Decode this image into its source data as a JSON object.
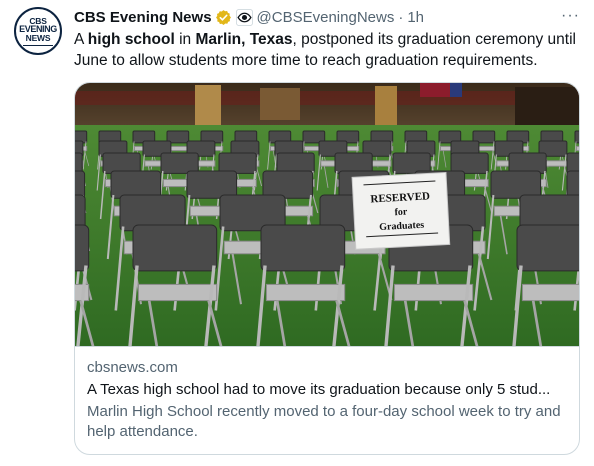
{
  "author": {
    "name": "CBS Evening News",
    "handle": "@CBSEveningNews",
    "separator": "·",
    "time": "1h",
    "avatar_lines": [
      "CBS",
      "EVENING",
      "NEWS"
    ],
    "avatar_icon": "cbs-evening-news-logo",
    "verified_badge": "gold-check-icon",
    "affiliation_icon": "cbs-eye-icon"
  },
  "more_label": "···",
  "tweet_text": [
    {
      "t": "A "
    },
    {
      "t": "high school",
      "bold": true
    },
    {
      "t": " in "
    },
    {
      "t": "Marlin, Texas",
      "bold": true
    },
    {
      "t": ", postponed its graduation ceremony until June to allow students more time to reach graduation requirements."
    }
  ],
  "card": {
    "sign_lines": [
      "RESERVED",
      "for",
      "Graduates"
    ],
    "domain": "cbsnews.com",
    "title": "A Texas high school had to move its graduation because only 5 stud...",
    "description": "Marlin High School recently moved to a four-day school week to try and help attendance."
  },
  "colors": {
    "text": "#0f1419",
    "secondary": "#536471",
    "border": "#cfd9de",
    "verified_gold": "#e2b719",
    "grass": "#3f7a2e"
  }
}
